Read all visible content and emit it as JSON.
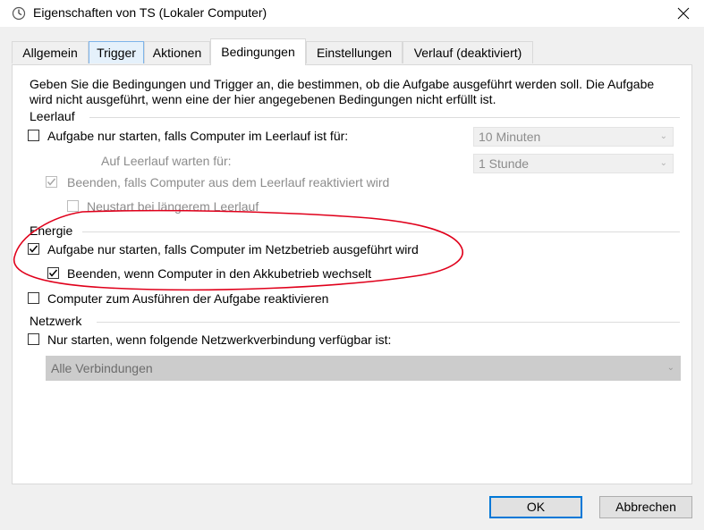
{
  "window": {
    "title": "Eigenschaften von TS (Lokaler Computer)",
    "icon": "clock-icon"
  },
  "tabs": [
    {
      "label": "Allgemein"
    },
    {
      "label": "Trigger"
    },
    {
      "label": "Aktionen"
    },
    {
      "label": "Bedingungen",
      "active": true
    },
    {
      "label": "Einstellungen"
    },
    {
      "label": "Verlauf (deaktiviert)"
    }
  ],
  "description": "Geben Sie die Bedingungen und Trigger an, die bestimmen, ob die Aufgabe ausgeführt werden soll. Die Aufgabe wird nicht ausgeführt, wenn eine der hier angegebenen Bedingungen nicht erfüllt ist.",
  "idle": {
    "group_label": "Leerlauf",
    "start_if_idle": {
      "label": "Aufgabe nur starten, falls Computer im Leerlauf ist für:",
      "checked": false
    },
    "idle_duration": {
      "value": "10 Minuten"
    },
    "wait_label": "Auf Leerlauf warten für:",
    "wait_duration": {
      "value": "1 Stunde"
    },
    "stop_if_not_idle": {
      "label": "Beenden, falls Computer aus dem Leerlauf reaktiviert wird",
      "checked": true
    },
    "restart_if_idle": {
      "label": "Neustart bei längerem Leerlauf",
      "checked": false
    }
  },
  "power": {
    "group_label": "Energie",
    "ac_only": {
      "label": "Aufgabe nur starten, falls Computer im Netzbetrieb ausgeführt wird",
      "checked": true
    },
    "stop_on_battery": {
      "label": "Beenden, wenn Computer in den Akkubetrieb wechselt",
      "checked": true
    },
    "wake_to_run": {
      "label": "Computer zum Ausführen der Aufgabe reaktivieren",
      "checked": false
    }
  },
  "network": {
    "group_label": "Netzwerk",
    "network_only": {
      "label": "Nur starten, wenn folgende Netzwerkverbindung verfügbar ist:",
      "checked": false
    },
    "connection": {
      "value": "Alle Verbindungen"
    }
  },
  "buttons": {
    "ok": "OK",
    "cancel": "Abbrechen"
  },
  "colors": {
    "accent": "#0078d7",
    "annotation": "#e0001b"
  }
}
